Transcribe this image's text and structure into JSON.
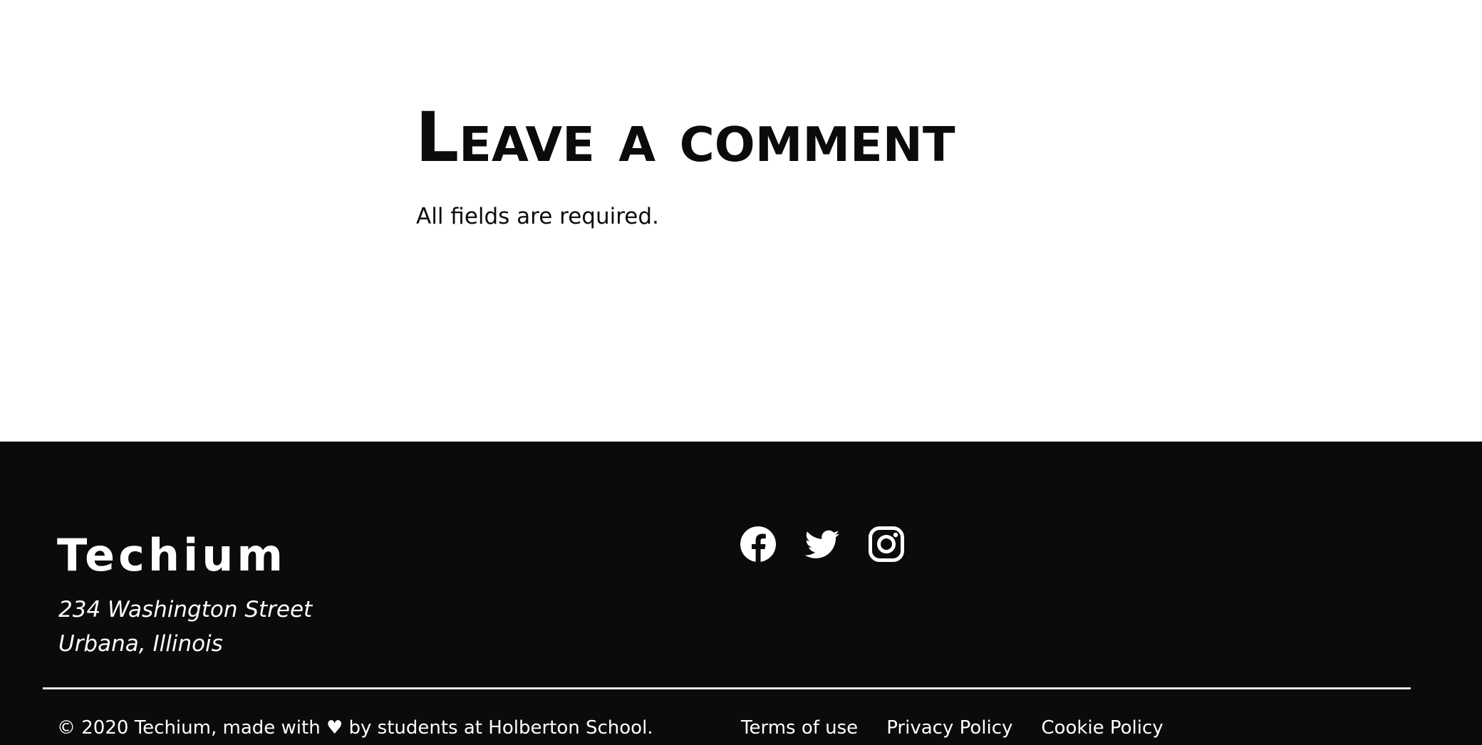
{
  "comment_section": {
    "title": "Leave a comment",
    "subtitle": "All fields are required."
  },
  "footer": {
    "brand": "Techium",
    "address": {
      "line1": "234 Washington Street",
      "line2": "Urbana, Illinois"
    },
    "socials": [
      {
        "name": "facebook-icon"
      },
      {
        "name": "twitter-icon"
      },
      {
        "name": "instagram-icon"
      }
    ],
    "copyright": "© 2020 Techium, made with ♥ by students at Holberton School.",
    "links": {
      "terms": "Terms of use",
      "privacy": "Privacy Policy",
      "cookie": "Cookie Policy"
    }
  },
  "colors": {
    "background": "#ffffff",
    "footer_bg": "#0b0b0b",
    "text_dark": "#0b0b0b",
    "text_light": "#ffffff",
    "divider": "#e6e6e6"
  }
}
